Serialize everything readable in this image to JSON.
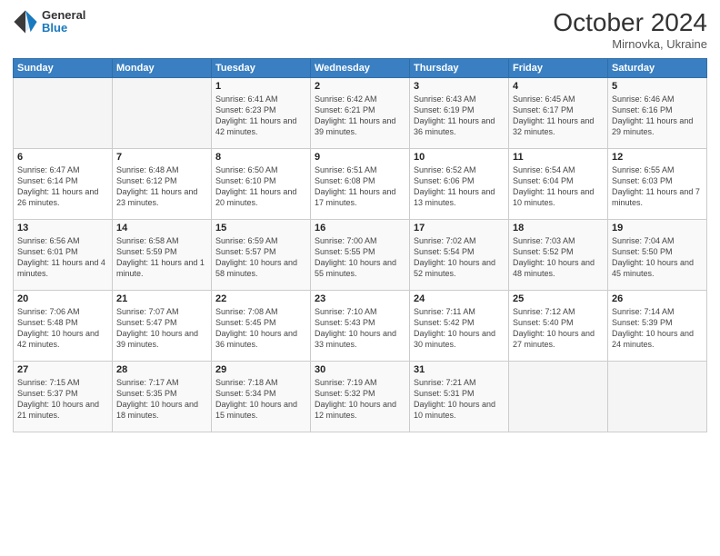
{
  "header": {
    "logo_general": "General",
    "logo_blue": "Blue",
    "month": "October 2024",
    "location": "Mirnovka, Ukraine"
  },
  "weekdays": [
    "Sunday",
    "Monday",
    "Tuesday",
    "Wednesday",
    "Thursday",
    "Friday",
    "Saturday"
  ],
  "weeks": [
    [
      {
        "day": "",
        "info": ""
      },
      {
        "day": "",
        "info": ""
      },
      {
        "day": "1",
        "info": "Sunrise: 6:41 AM\nSunset: 6:23 PM\nDaylight: 11 hours and 42 minutes."
      },
      {
        "day": "2",
        "info": "Sunrise: 6:42 AM\nSunset: 6:21 PM\nDaylight: 11 hours and 39 minutes."
      },
      {
        "day": "3",
        "info": "Sunrise: 6:43 AM\nSunset: 6:19 PM\nDaylight: 11 hours and 36 minutes."
      },
      {
        "day": "4",
        "info": "Sunrise: 6:45 AM\nSunset: 6:17 PM\nDaylight: 11 hours and 32 minutes."
      },
      {
        "day": "5",
        "info": "Sunrise: 6:46 AM\nSunset: 6:16 PM\nDaylight: 11 hours and 29 minutes."
      }
    ],
    [
      {
        "day": "6",
        "info": "Sunrise: 6:47 AM\nSunset: 6:14 PM\nDaylight: 11 hours and 26 minutes."
      },
      {
        "day": "7",
        "info": "Sunrise: 6:48 AM\nSunset: 6:12 PM\nDaylight: 11 hours and 23 minutes."
      },
      {
        "day": "8",
        "info": "Sunrise: 6:50 AM\nSunset: 6:10 PM\nDaylight: 11 hours and 20 minutes."
      },
      {
        "day": "9",
        "info": "Sunrise: 6:51 AM\nSunset: 6:08 PM\nDaylight: 11 hours and 17 minutes."
      },
      {
        "day": "10",
        "info": "Sunrise: 6:52 AM\nSunset: 6:06 PM\nDaylight: 11 hours and 13 minutes."
      },
      {
        "day": "11",
        "info": "Sunrise: 6:54 AM\nSunset: 6:04 PM\nDaylight: 11 hours and 10 minutes."
      },
      {
        "day": "12",
        "info": "Sunrise: 6:55 AM\nSunset: 6:03 PM\nDaylight: 11 hours and 7 minutes."
      }
    ],
    [
      {
        "day": "13",
        "info": "Sunrise: 6:56 AM\nSunset: 6:01 PM\nDaylight: 11 hours and 4 minutes."
      },
      {
        "day": "14",
        "info": "Sunrise: 6:58 AM\nSunset: 5:59 PM\nDaylight: 11 hours and 1 minute."
      },
      {
        "day": "15",
        "info": "Sunrise: 6:59 AM\nSunset: 5:57 PM\nDaylight: 10 hours and 58 minutes."
      },
      {
        "day": "16",
        "info": "Sunrise: 7:00 AM\nSunset: 5:55 PM\nDaylight: 10 hours and 55 minutes."
      },
      {
        "day": "17",
        "info": "Sunrise: 7:02 AM\nSunset: 5:54 PM\nDaylight: 10 hours and 52 minutes."
      },
      {
        "day": "18",
        "info": "Sunrise: 7:03 AM\nSunset: 5:52 PM\nDaylight: 10 hours and 48 minutes."
      },
      {
        "day": "19",
        "info": "Sunrise: 7:04 AM\nSunset: 5:50 PM\nDaylight: 10 hours and 45 minutes."
      }
    ],
    [
      {
        "day": "20",
        "info": "Sunrise: 7:06 AM\nSunset: 5:48 PM\nDaylight: 10 hours and 42 minutes."
      },
      {
        "day": "21",
        "info": "Sunrise: 7:07 AM\nSunset: 5:47 PM\nDaylight: 10 hours and 39 minutes."
      },
      {
        "day": "22",
        "info": "Sunrise: 7:08 AM\nSunset: 5:45 PM\nDaylight: 10 hours and 36 minutes."
      },
      {
        "day": "23",
        "info": "Sunrise: 7:10 AM\nSunset: 5:43 PM\nDaylight: 10 hours and 33 minutes."
      },
      {
        "day": "24",
        "info": "Sunrise: 7:11 AM\nSunset: 5:42 PM\nDaylight: 10 hours and 30 minutes."
      },
      {
        "day": "25",
        "info": "Sunrise: 7:12 AM\nSunset: 5:40 PM\nDaylight: 10 hours and 27 minutes."
      },
      {
        "day": "26",
        "info": "Sunrise: 7:14 AM\nSunset: 5:39 PM\nDaylight: 10 hours and 24 minutes."
      }
    ],
    [
      {
        "day": "27",
        "info": "Sunrise: 7:15 AM\nSunset: 5:37 PM\nDaylight: 10 hours and 21 minutes."
      },
      {
        "day": "28",
        "info": "Sunrise: 7:17 AM\nSunset: 5:35 PM\nDaylight: 10 hours and 18 minutes."
      },
      {
        "day": "29",
        "info": "Sunrise: 7:18 AM\nSunset: 5:34 PM\nDaylight: 10 hours and 15 minutes."
      },
      {
        "day": "30",
        "info": "Sunrise: 7:19 AM\nSunset: 5:32 PM\nDaylight: 10 hours and 12 minutes."
      },
      {
        "day": "31",
        "info": "Sunrise: 7:21 AM\nSunset: 5:31 PM\nDaylight: 10 hours and 10 minutes."
      },
      {
        "day": "",
        "info": ""
      },
      {
        "day": "",
        "info": ""
      }
    ]
  ]
}
